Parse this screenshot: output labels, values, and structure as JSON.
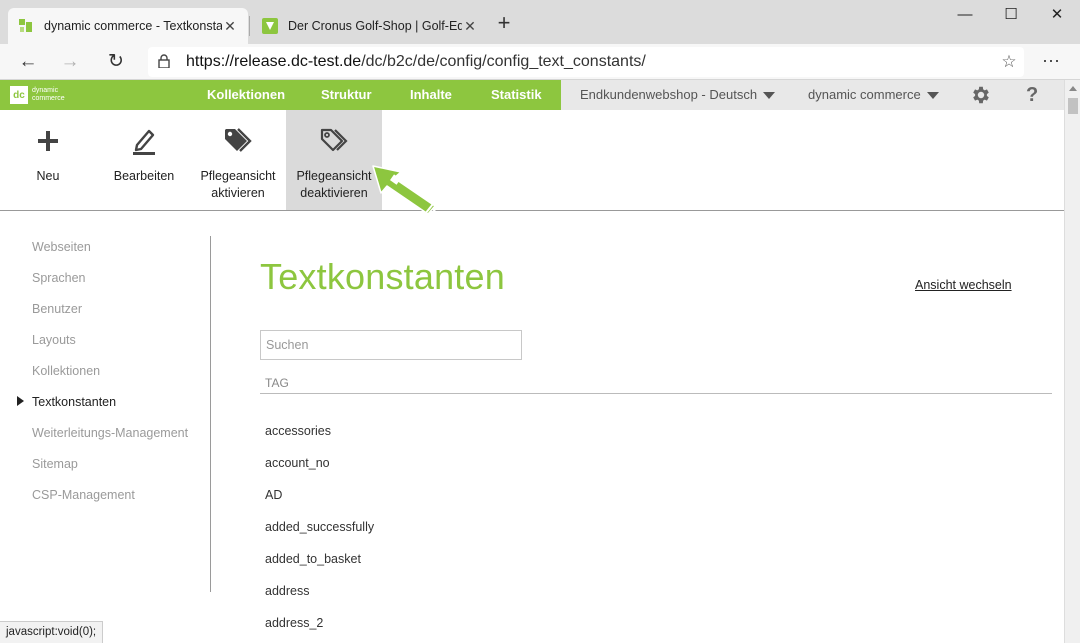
{
  "browser": {
    "tabs": [
      {
        "title": "dynamic commerce - Textkonstanten",
        "close": "✕"
      },
      {
        "title": "Der Cronus Golf-Shop | Golf-Equipment",
        "close": "✕"
      }
    ],
    "new_tab": "+",
    "window": {
      "minimize": "—",
      "maximize": "☐",
      "close": "✕"
    },
    "url_host": "https://release.dc-test.de",
    "url_path": "/dc/b2c/de/config/config_text_constants/",
    "more": "···"
  },
  "topnav": {
    "logo_line1": "dynamic",
    "logo_line2": "commerce",
    "items": [
      "Kollektionen",
      "Struktur",
      "Inhalte",
      "Statistik"
    ],
    "shop_select": "Endkundenwebshop - Deutsch",
    "company_select": "dynamic commerce",
    "help": "?"
  },
  "toolbar": {
    "new": "Neu",
    "edit": "Bearbeiten",
    "activate_l1": "Pflegeansicht",
    "activate_l2": "aktivieren",
    "deactivate_l1": "Pflegeansicht",
    "deactivate_l2": "deaktivieren"
  },
  "sidebar": {
    "items": [
      "Webseiten",
      "Sprachen",
      "Benutzer",
      "Layouts",
      "Kollektionen",
      "Textkonstanten",
      "Weiterleitungs-Management",
      "Sitemap",
      "CSP-Management"
    ],
    "active_index": 5
  },
  "main": {
    "title": "Textkonstanten",
    "switch_view": "Ansicht wechseln",
    "search_placeholder": "Suchen",
    "column_header": "TAG",
    "rows": [
      "accessories",
      "account_no",
      "AD",
      "added_successfully",
      "added_to_basket",
      "address",
      "address_2"
    ]
  },
  "status_bar": "javascript:void(0);",
  "colors": {
    "brand_green": "#8dc63f",
    "nav_right_bg": "#e8e8e8",
    "selected_tool_bg": "#dadada"
  }
}
